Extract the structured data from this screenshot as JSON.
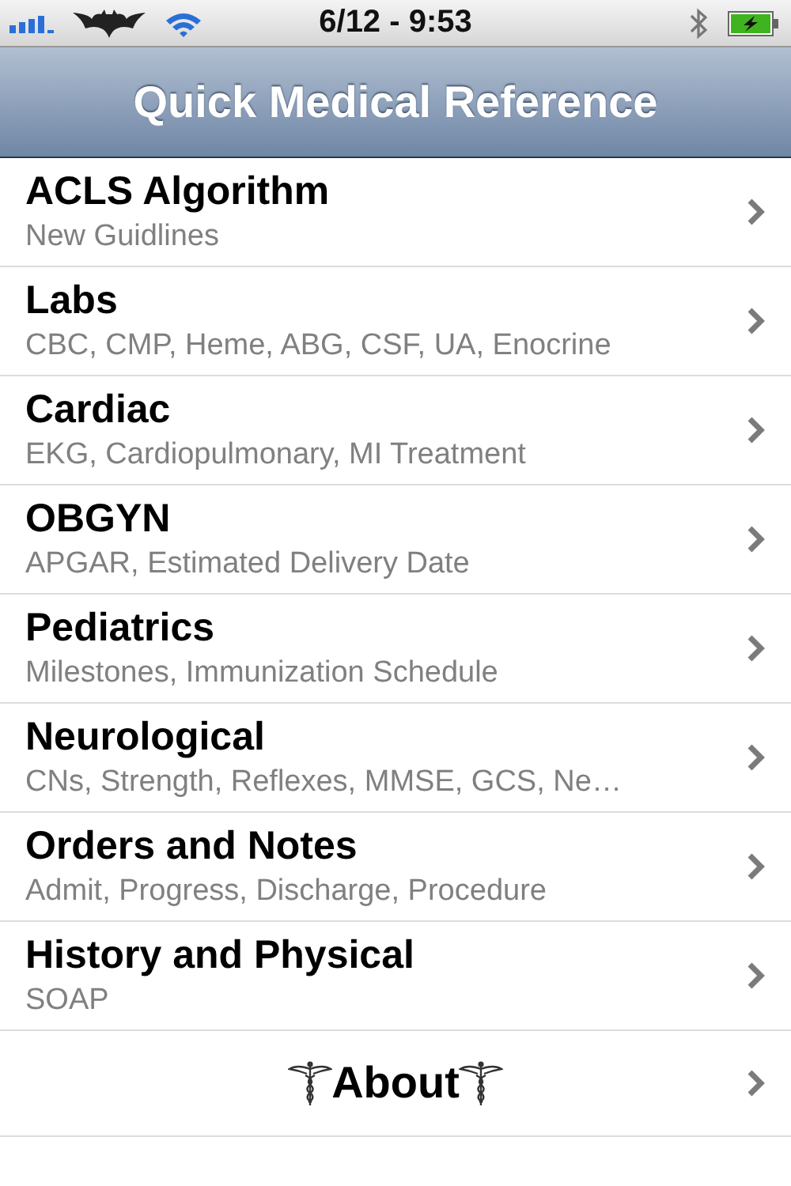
{
  "status_bar": {
    "time": "6/12 - 9:53"
  },
  "nav_bar": {
    "title": "Quick Medical Reference"
  },
  "rows": [
    {
      "kind": "item",
      "title": "ACLS Algorithm",
      "subtitle": "New Guidlines"
    },
    {
      "kind": "item",
      "title": "Labs",
      "subtitle": "CBC, CMP, Heme, ABG, CSF, UA, Enocrine"
    },
    {
      "kind": "item",
      "title": "Cardiac",
      "subtitle": "EKG, Cardiopulmonary, MI Treatment"
    },
    {
      "kind": "item",
      "title": "OBGYN",
      "subtitle": "APGAR, Estimated Delivery Date"
    },
    {
      "kind": "item",
      "title": "Pediatrics",
      "subtitle": "Milestones, Immunization Schedule"
    },
    {
      "kind": "item",
      "title": "Neurological",
      "subtitle": "CNs, Strength, Reflexes, MMSE, GCS, Ne…"
    },
    {
      "kind": "item",
      "title": "Orders and Notes",
      "subtitle": "Admit, Progress, Discharge, Procedure"
    },
    {
      "kind": "item",
      "title": "History and Physical",
      "subtitle": "SOAP"
    },
    {
      "kind": "about",
      "title": "About"
    }
  ]
}
